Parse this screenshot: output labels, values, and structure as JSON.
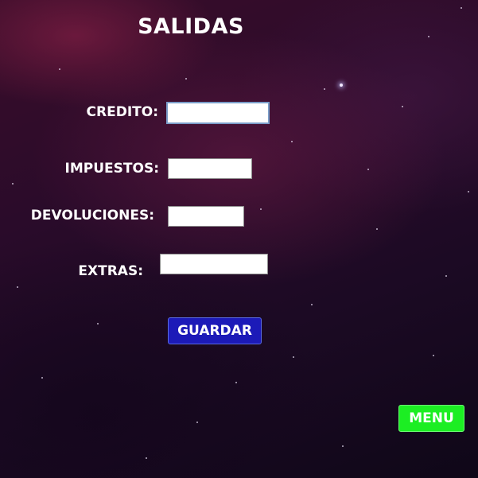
{
  "page": {
    "title": "SALIDAS"
  },
  "form": {
    "fields": [
      {
        "label": "CREDITO:",
        "value": ""
      },
      {
        "label": "IMPUESTOS:",
        "value": ""
      },
      {
        "label": "DEVOLUCIONES:",
        "value": ""
      },
      {
        "label": "EXTRAS:",
        "value": ""
      }
    ]
  },
  "buttons": {
    "save_label": "GUARDAR",
    "menu_label": "MENU"
  },
  "colors": {
    "save_button": "#1c1ab8",
    "menu_button": "#1cee23",
    "background": "#1c0a24"
  }
}
